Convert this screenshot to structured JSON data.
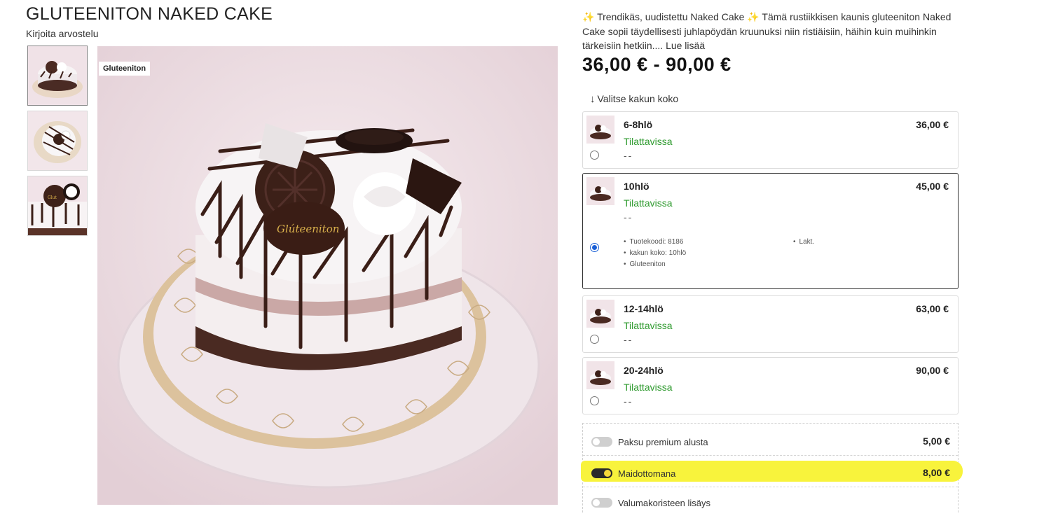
{
  "product": {
    "title": "GLUTEENITON NAKED CAKE",
    "review_link": "Kirjoita arvostelu",
    "badge": "Gluteeniton",
    "description": "✨ Trendikäs, uudistettu Naked Cake ✨ Tämä rustiikkisen kaunis gluteeniton Naked Cake sopii täydellisesti juhlapöydän kruunuksi niin ristiäisiin, häihin kuin muihinkin tärkeisiin hetkiin....",
    "read_more": "Lue lisää",
    "price_range": "36,00 € - 90,00 €"
  },
  "size_selector": {
    "label": "Valitse kakun koko",
    "options": [
      {
        "name": "6-8hlö",
        "status": "Tilattavissa",
        "dash": "--",
        "price": "36,00 €",
        "selected": false
      },
      {
        "name": "10hlö",
        "status": "Tilattavissa",
        "dash": "--",
        "price": "45,00 €",
        "selected": true,
        "details": [
          "Tuotekoodi: 8186",
          "kakun koko: 10hlö",
          "Gluteeniton"
        ],
        "details_right": [
          "Lakt."
        ]
      },
      {
        "name": "12-14hlö",
        "status": "Tilattavissa",
        "dash": "--",
        "price": "63,00 €",
        "selected": false
      },
      {
        "name": "20-24hlö",
        "status": "Tilattavissa",
        "dash": "--",
        "price": "90,00 €",
        "selected": false
      }
    ]
  },
  "addons": [
    {
      "label": "Paksu premium alusta",
      "price": "5,00 €",
      "on": false
    },
    {
      "label": "Maidottomana",
      "price": "8,00 €",
      "on": true,
      "highlighted": true
    },
    {
      "label": "Valumakoristeen lisäys",
      "price": "",
      "on": false
    }
  ],
  "colors": {
    "available": "#2e9a2e",
    "radio_selected": "#1a5fd6",
    "highlight": "#f8f33c",
    "toggle_on_knob": "#f6d93a"
  },
  "icons": {
    "arrow": "arrow-down-icon",
    "sparkle": "sparkle-icon"
  }
}
